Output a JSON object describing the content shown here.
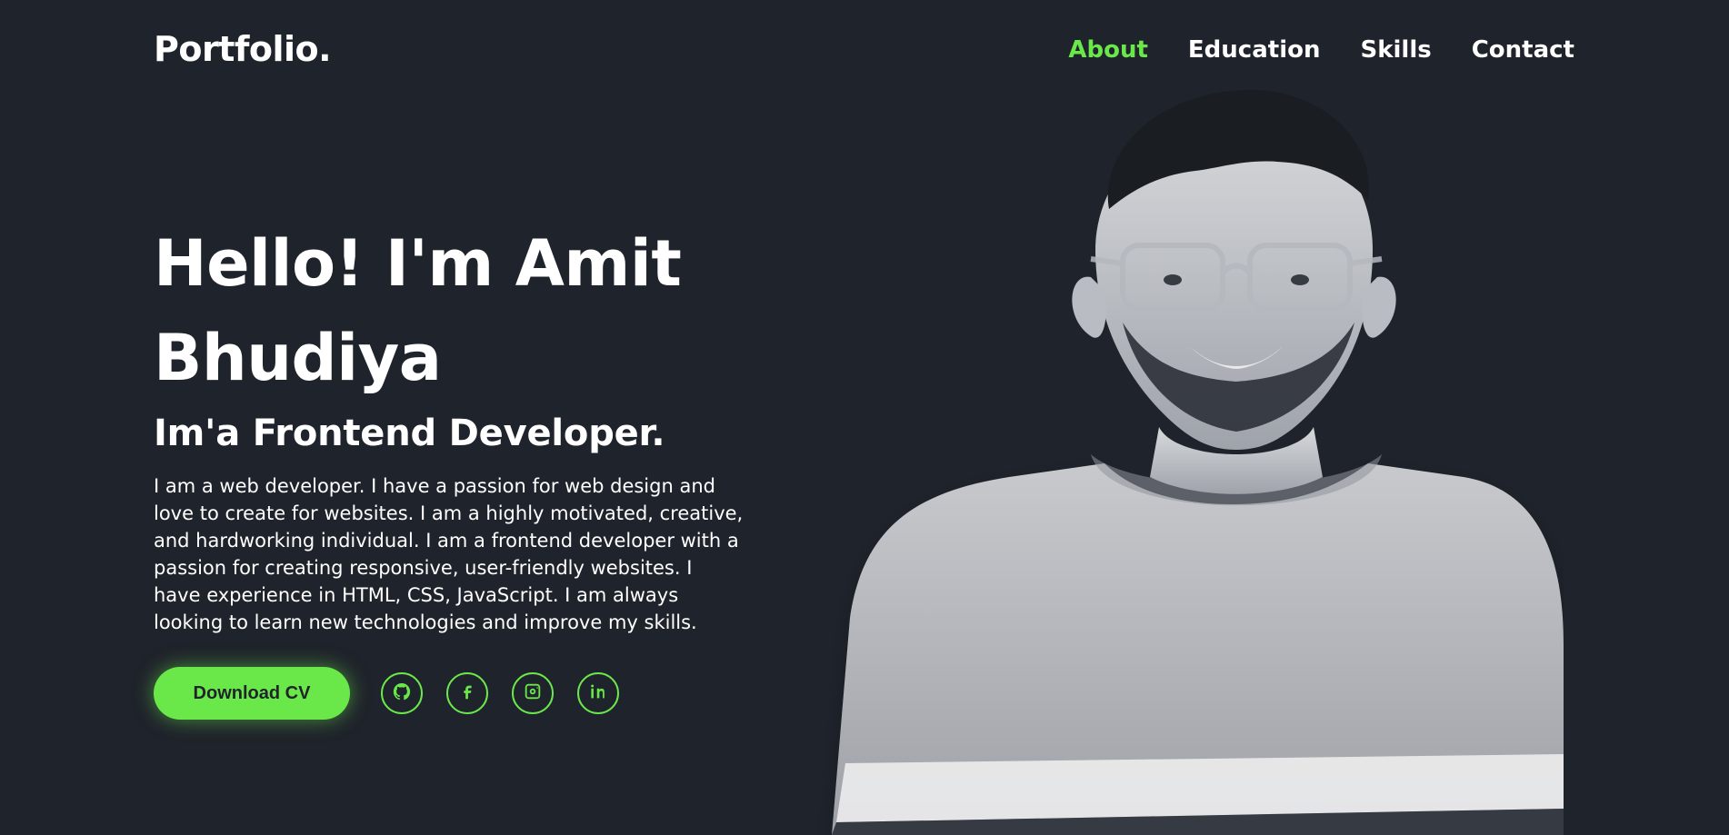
{
  "header": {
    "brand": "Portfolio.",
    "nav": {
      "items": [
        {
          "label": "About",
          "active": true
        },
        {
          "label": "Education",
          "active": false
        },
        {
          "label": "Skills",
          "active": false
        },
        {
          "label": "Contact",
          "active": false
        }
      ]
    }
  },
  "hero": {
    "title_line_1": "Hello! I'm Amit",
    "title_line_2": "Bhudiya",
    "subtitle": "Im'a Frontend Developer.",
    "description": "I am a web developer. I have a passion for web design and love to create for websites. I am a highly motivated, creative, and hardworking individual. I am a frontend developer with a passion for creating responsive, user-friendly websites. I have experience in HTML, CSS, JavaScript. I am always looking to learn new technologies and improve my skills.",
    "cta_label": "Download CV",
    "socials": [
      {
        "icon": "github-icon"
      },
      {
        "icon": "facebook-icon"
      },
      {
        "icon": "instagram-icon"
      },
      {
        "icon": "linkedin-icon"
      }
    ]
  },
  "colors": {
    "background": "#1f232b",
    "accent": "#6ae84a",
    "text": "#ffffff"
  }
}
